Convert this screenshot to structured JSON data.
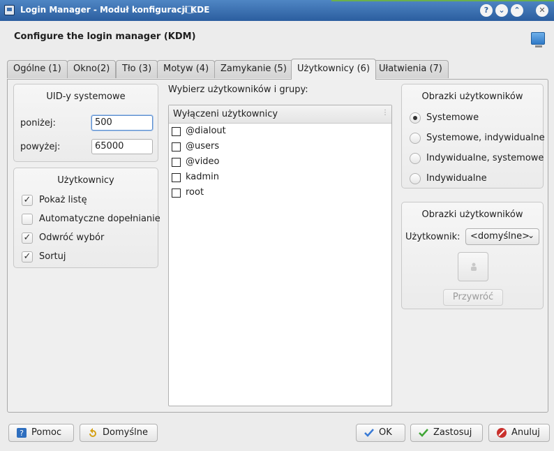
{
  "window": {
    "title": "Login Manager - Moduł konfiguracji KDE"
  },
  "header": {
    "title": "Configure the login manager (KDM)"
  },
  "tabs": [
    {
      "label": "Ogólne (1)"
    },
    {
      "label": "Okno(2)"
    },
    {
      "label": "Tło (3)"
    },
    {
      "label": "Motyw (4)"
    },
    {
      "label": "Zamykanie (5)"
    },
    {
      "label": "Użytkownicy (6)"
    },
    {
      "label": "Ułatwienia (7)"
    }
  ],
  "active_tab": "Użytkownicy (6)",
  "uid_group": {
    "title": "UID-y systemowe",
    "below_label": "poniżej:",
    "below_value": "500",
    "above_label": "powyżej:",
    "above_value": "65000"
  },
  "users_group": {
    "title": "Użytkownicy",
    "options": [
      {
        "label": "Pokaż listę",
        "checked": true
      },
      {
        "label": "Automatyczne dopełnianie",
        "checked": false
      },
      {
        "label": "Odwróć wybór",
        "checked": true
      },
      {
        "label": "Sortuj",
        "checked": true
      }
    ]
  },
  "selection": {
    "label": "Wybierz użytkowników i grupy:",
    "list_header": "Wyłączeni użytkownicy",
    "items": [
      {
        "label": "@dialout",
        "checked": false
      },
      {
        "label": "@users",
        "checked": false
      },
      {
        "label": "@video",
        "checked": false
      },
      {
        "label": "kadmin",
        "checked": false
      },
      {
        "label": "root",
        "checked": false
      }
    ]
  },
  "pictures_source": {
    "title": "Obrazki użytkowników",
    "options": [
      {
        "label": "Systemowe",
        "selected": true
      },
      {
        "label": "Systemowe, indywidualne",
        "selected": false
      },
      {
        "label": "Indywidualne, systemowe",
        "selected": false
      },
      {
        "label": "Indywidualne",
        "selected": false
      }
    ]
  },
  "pictures_user": {
    "title": "Obrazki użytkowników",
    "user_label": "Użytkownik:",
    "user_value": "<domyślne>",
    "restore_label": "Przywróć"
  },
  "buttons": {
    "help": "Pomoc",
    "defaults": "Domyślne",
    "ok": "OK",
    "apply": "Zastosuj",
    "cancel": "Anuluj"
  },
  "colors": {
    "titlebar": "#2b5e9f",
    "ok_check": "#3a7bd5",
    "apply_check": "#3fa535",
    "cancel_icon": "#c9302c"
  }
}
